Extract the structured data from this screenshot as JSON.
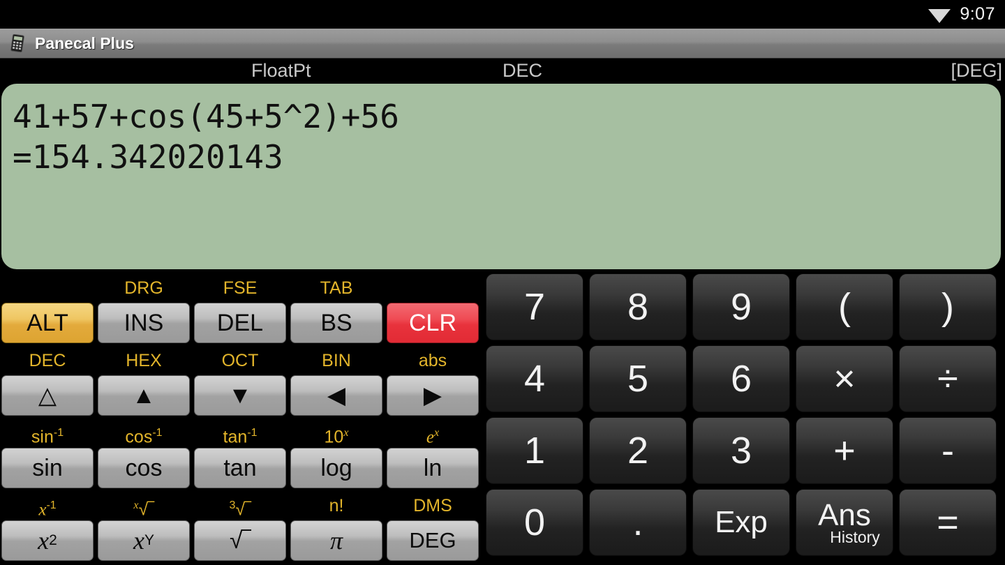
{
  "statusbar": {
    "wifi_icon": "wifi-icon",
    "time": "9:07"
  },
  "titlebar": {
    "icon": "calculator-icon",
    "title": "Panecal Plus"
  },
  "modebar": {
    "notation": "FloatPt",
    "base": "DEC",
    "angle": "[DEG]"
  },
  "display": {
    "expression": "41+57+cos(45+5^2)+56",
    "result": "=154.342020143",
    "background_color": "#a6bfa1"
  },
  "colors": {
    "alt_accent": "#e3aa3c",
    "clear_accent": "#e8323c",
    "shift_label": "#e3b52b",
    "display_bg": "#a6bfa1"
  },
  "function_panel": {
    "rows": [
      {
        "keys": [
          {
            "shift": "",
            "label": "ALT",
            "name": "alt-button",
            "style": "alt"
          },
          {
            "shift": "DRG",
            "label": "INS",
            "name": "ins-button",
            "style": "gray"
          },
          {
            "shift": "FSE",
            "label": "DEL",
            "name": "del-button",
            "style": "gray"
          },
          {
            "shift": "TAB",
            "label": "BS",
            "name": "bs-button",
            "style": "gray"
          },
          {
            "shift": "",
            "label": "CLR",
            "name": "clear-button",
            "style": "clr"
          }
        ]
      },
      {
        "keys": [
          {
            "shift": "DEC",
            "label": "△",
            "name": "cursor-home-button",
            "style": "gray"
          },
          {
            "shift": "HEX",
            "label": "▲",
            "name": "cursor-up-button",
            "style": "gray"
          },
          {
            "shift": "OCT",
            "label": "▼",
            "name": "cursor-down-button",
            "style": "gray"
          },
          {
            "shift": "BIN",
            "label": "◀",
            "name": "cursor-left-button",
            "style": "gray"
          },
          {
            "shift": "abs",
            "label": "▶",
            "name": "cursor-right-button",
            "style": "gray"
          }
        ]
      },
      {
        "keys": [
          {
            "shift": "sin-1",
            "label": "sin",
            "name": "sin-button",
            "style": "gray"
          },
          {
            "shift": "cos-1",
            "label": "cos",
            "name": "cos-button",
            "style": "gray"
          },
          {
            "shift": "tan-1",
            "label": "tan",
            "name": "tan-button",
            "style": "gray"
          },
          {
            "shift": "10x",
            "label": "log",
            "name": "log-button",
            "style": "gray"
          },
          {
            "shift": "ex",
            "label": "ln",
            "name": "ln-button",
            "style": "gray"
          }
        ]
      },
      {
        "keys": [
          {
            "shift": "x-1",
            "label": "x2",
            "name": "square-button",
            "style": "gray"
          },
          {
            "shift": "xroot",
            "label": "xY",
            "name": "power-button",
            "style": "gray"
          },
          {
            "shift": "cbrt",
            "label": "sqrt",
            "name": "sqrt-button",
            "style": "gray"
          },
          {
            "shift": "n!",
            "label": "pi",
            "name": "pi-button",
            "style": "gray"
          },
          {
            "shift": "DMS",
            "label": "DEG",
            "name": "deg-button",
            "style": "gray"
          }
        ]
      }
    ]
  },
  "keypad": {
    "rows": [
      [
        {
          "label": "7",
          "name": "key-7"
        },
        {
          "label": "8",
          "name": "key-8"
        },
        {
          "label": "9",
          "name": "key-9"
        },
        {
          "label": "(",
          "name": "key-open-paren"
        },
        {
          "label": ")",
          "name": "key-close-paren"
        }
      ],
      [
        {
          "label": "4",
          "name": "key-4"
        },
        {
          "label": "5",
          "name": "key-5"
        },
        {
          "label": "6",
          "name": "key-6"
        },
        {
          "label": "×",
          "name": "key-multiply"
        },
        {
          "label": "÷",
          "name": "key-divide"
        }
      ],
      [
        {
          "label": "1",
          "name": "key-1"
        },
        {
          "label": "2",
          "name": "key-2"
        },
        {
          "label": "3",
          "name": "key-3"
        },
        {
          "label": "+",
          "name": "key-plus"
        },
        {
          "label": "-",
          "name": "key-minus"
        }
      ],
      [
        {
          "label": "0",
          "name": "key-0"
        },
        {
          "label": ".",
          "name": "key-decimal"
        },
        {
          "label": "Exp",
          "name": "key-exp",
          "text": true
        },
        {
          "label": "Ans",
          "sub": "History",
          "name": "key-ans"
        },
        {
          "label": "=",
          "name": "key-equals"
        }
      ]
    ]
  }
}
